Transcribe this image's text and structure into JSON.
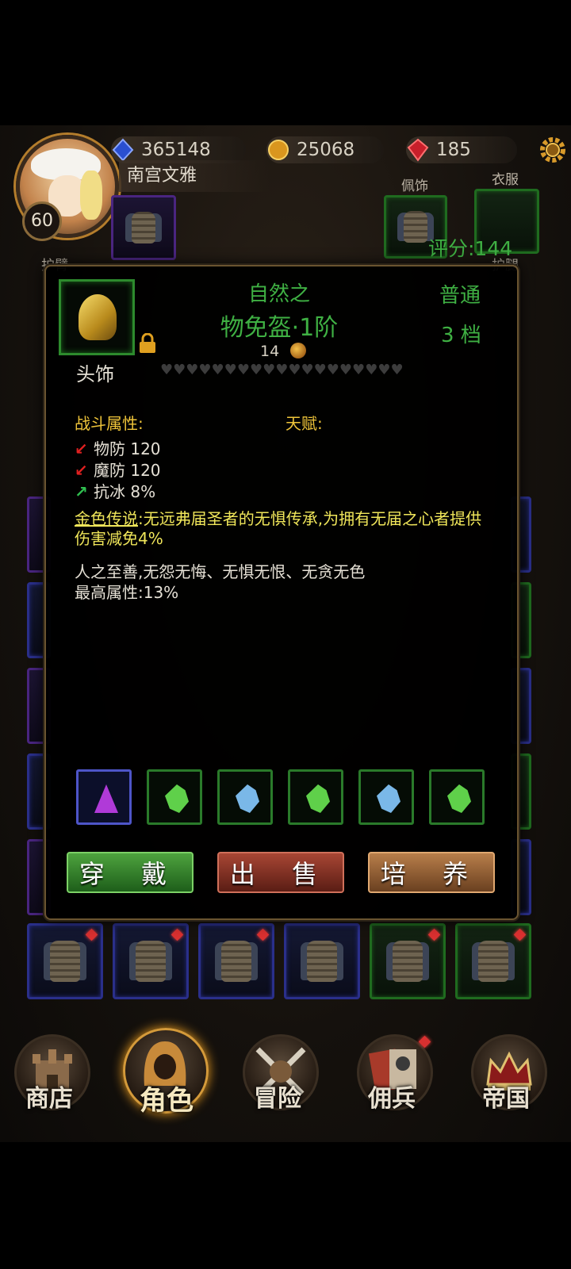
{
  "player": {
    "name": "南宫文雅",
    "level": "60"
  },
  "resources": {
    "diamonds": "365148",
    "coins": "25068",
    "rubies": "185"
  },
  "score": "评分:144",
  "equip_labels": {
    "armguard": "护臂",
    "ornament": "佩饰",
    "clothes": "衣服",
    "legguard": "护腿"
  },
  "item": {
    "name_line1": "自然之",
    "name_line2": "物免盔·1阶",
    "price": "14",
    "rarity": "普通",
    "grade": "3 档",
    "slot": "头饰",
    "hearts": "♥♥♥♥♥♥♥♥♥♥♥♥♥♥♥♥♥♥♥♥♥♥♥♥♥♥♥♥♥♥♥♥♥♥♥♥♥♥♥♥♥♥♥♥♥♥♥♥♥♥♥♥♥♥♥♥♥♥♥♥♥♥♥♥♥♥♥♥♥♥♥♥♥♥♥♥♥♥♥♥♥♥♥♥♥♥♥♥♥♥♥♥♥♥♥♥♥♥♥♥♥♥♥♥♥♥♥♥♥♥♥♥♥♥♥♥♥♥♥♥♥♥♥♥♥♥♥♥♥♥♥♥♥♥♥♥♥♥♥♥♥♥♥♥♥♥♥♥♥♥♥♥♥♥♥♥♥♥♥♥♥♥♥♥♥♥♥♥♥♥♥♥♥♥♥♥♥♥♥♥♥♥♥♥♥♥♥♥♥♥♥♥♥♥♥♥♥♥♥♥♥♥♥♥♥♥♥♥♥♥♥♥♥♥♥♥",
    "combat_header": "战斗属性:",
    "talent_header": "天赋:",
    "attrs": [
      {
        "name": "物防",
        "value": "120",
        "dir": "down"
      },
      {
        "name": "魔防",
        "value": "120",
        "dir": "down"
      },
      {
        "name": "抗冰",
        "value": "8%",
        "dir": "up"
      }
    ],
    "legend_title": "金色传说",
    "legend_text": ":无远弗届圣者的无惧传承,为拥有无届之心者提供伤害减免4%",
    "desc_line1": "人之至善,无怨无悔、无惧无恨、无贪无色",
    "desc_line2": "最高属性:13%"
  },
  "gems": [
    {
      "type": "purple",
      "frame": "blue",
      "color": "#b03ad8"
    },
    {
      "type": "green",
      "frame": "green",
      "color": "#5fd04a"
    },
    {
      "type": "blue",
      "frame": "green",
      "color": "#7ab8e8"
    },
    {
      "type": "green",
      "frame": "green",
      "color": "#5fd04a"
    },
    {
      "type": "blue",
      "frame": "green",
      "color": "#7ab8e8"
    },
    {
      "type": "green",
      "frame": "green",
      "color": "#5fd04a"
    }
  ],
  "buttons": {
    "wear": "穿 戴",
    "sell": "出 售",
    "train": "培 养"
  },
  "nav": [
    {
      "label": "商店",
      "icon": "castle-icon"
    },
    {
      "label": "角色",
      "icon": "hooded-figure-icon",
      "active": true
    },
    {
      "label": "冒险",
      "icon": "crossed-swords-icon"
    },
    {
      "label": "佣兵",
      "icon": "cards-icon"
    },
    {
      "label": "帝国",
      "icon": "crown-icon"
    }
  ]
}
